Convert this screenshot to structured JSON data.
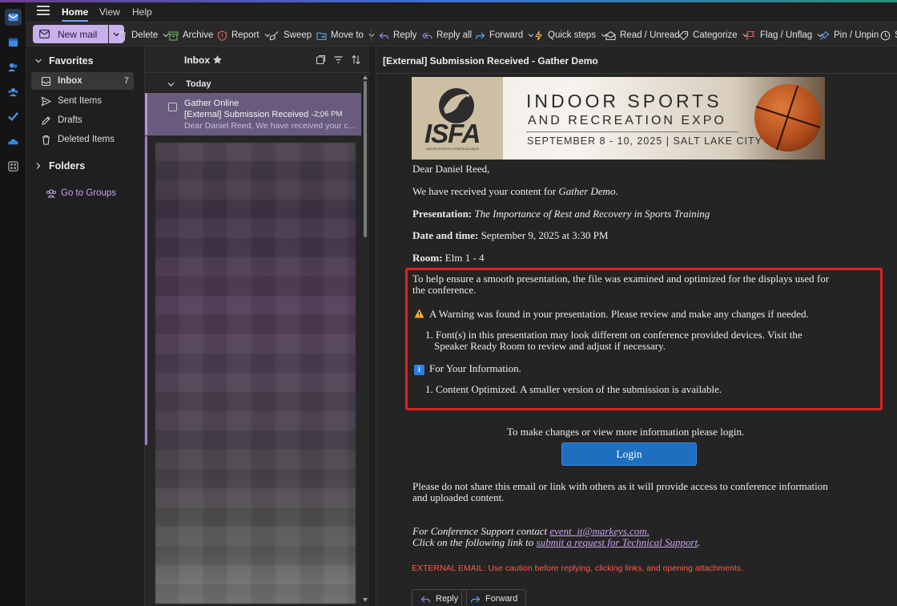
{
  "menu": {
    "tabs": [
      "Home",
      "View",
      "Help"
    ],
    "active": "Home"
  },
  "ribbon": {
    "new_mail": "New mail",
    "delete": "Delete",
    "archive": "Archive",
    "report": "Report",
    "sweep": "Sweep",
    "move_to": "Move to",
    "reply": "Reply",
    "reply_all": "Reply all",
    "forward": "Forward",
    "quick_steps": "Quick steps",
    "read_unread": "Read / Unread",
    "categorize": "Categorize",
    "flag_unflag": "Flag / Unflag",
    "pin_unpin": "Pin / Unpin",
    "overflow_label": "S"
  },
  "folders": {
    "favorites_label": "Favorites",
    "items": [
      {
        "label": "Inbox",
        "count": "7",
        "icon": "inbox-icon"
      },
      {
        "label": "Sent Items",
        "count": "",
        "icon": "send-icon"
      },
      {
        "label": "Drafts",
        "count": "",
        "icon": "pencil-icon"
      },
      {
        "label": "Deleted Items",
        "count": "",
        "icon": "trash-icon"
      }
    ],
    "folders_label": "Folders",
    "groups_link": "Go to Groups"
  },
  "message_list": {
    "title": "Inbox",
    "group_label": "Today",
    "selected": {
      "sender": "Gather Online",
      "subject": "[External] Submission Received - ...",
      "time": "2:06 PM",
      "preview": "Dear Daniel Reed, We have received your c..."
    }
  },
  "email": {
    "subject": "[External] Submission Received - Gather Demo",
    "banner": {
      "logo_text": "ISFA",
      "logo_sub": "INDOOR SPORTS & FITNESS ALLIANCE",
      "line1": "INDOOR SPORTS",
      "line2": "AND RECREATION EXPO",
      "line3": "SEPTEMBER 8 - 10, 2025 | SALT LAKE CITY"
    },
    "greeting": "Dear Daniel Reed,",
    "received_prefix": "We have received your content for ",
    "received_event": "Gather Demo",
    "received_suffix": ".",
    "presentation_label": "Presentation:",
    "presentation_title": "The Importance of Rest and Recovery in Sports Training",
    "datetime_label": "Date and time:",
    "datetime_value": "September 9, 2025 at 3:30 PM",
    "room_label": "Room:",
    "room_value": "Elm 1 - 4",
    "optimize_line1": "To help ensure a smooth presentation, the file was examined and optimized for the displays used for",
    "optimize_line2": "the conference.",
    "warning_text": "A Warning was found in your presentation. Please review and make any changes if needed.",
    "warning_item_num": "1.",
    "warning_item_line1": "Font(s) in this presentation may look different on conference provided devices. Visit the",
    "warning_item_line2": "Speaker Ready Room to review and adjust if necessary.",
    "info_text": "For Your Information.",
    "info_item_num": "1.",
    "info_item": "Content Optimized. A smaller version of the submission is available.",
    "login_prompt": "To make changes or view more information please login.",
    "login_button": "Login",
    "share_line1": "Please do not share this email or link with others as it will provide access to conference information",
    "share_line2": "and uploaded content.",
    "support_prefix": "For Conference Support contact ",
    "support_email": "event_it@markeys.com.",
    "tech_prefix": "Click on the following link to ",
    "tech_link": "submit a request for Technical Support",
    "tech_suffix": ".",
    "external_warning": "EXTERNAL EMAIL: Use caution before replying, clicking links, and opening attachments.",
    "reply_button": "Reply",
    "forward_button": "Forward"
  },
  "colors": {
    "accent": "#c8b0ea",
    "highlight_box": "#e32020",
    "login": "#1f6fbf",
    "external_warning": "#ff5a4a"
  }
}
